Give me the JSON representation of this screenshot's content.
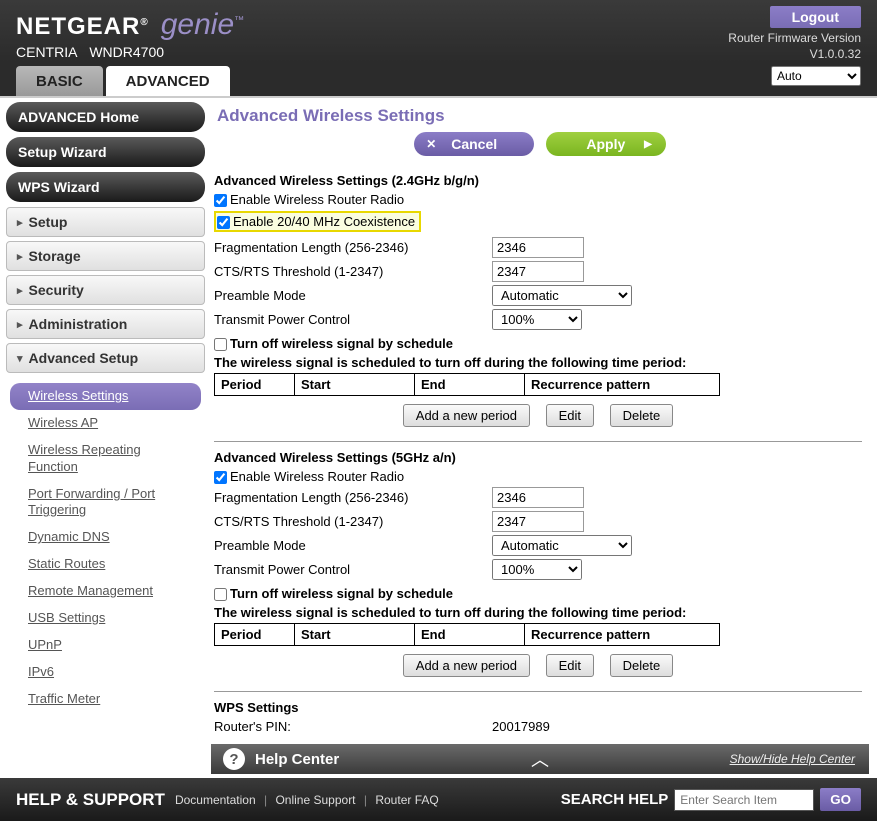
{
  "header": {
    "brand": "NETGEAR",
    "sub_brand": "genie",
    "model_line": "CENTRIA",
    "model_num": "WNDR4700",
    "logout": "Logout",
    "fw_label": "Router Firmware Version",
    "fw_version": "V1.0.0.32"
  },
  "tabs": {
    "basic": "BASIC",
    "advanced": "ADVANCED",
    "lang_selected": "Auto"
  },
  "sidebar": {
    "home": "ADVANCED Home",
    "setup_wizard": "Setup Wizard",
    "wps_wizard": "WPS Wizard",
    "groups": {
      "setup": "Setup",
      "storage": "Storage",
      "security": "Security",
      "admin": "Administration",
      "adv_setup": "Advanced Setup"
    },
    "adv_items": [
      "Wireless Settings",
      "Wireless AP",
      "Wireless Repeating Function",
      "Port Forwarding / Port Triggering",
      "Dynamic DNS",
      "Static Routes",
      "Remote Management",
      "USB Settings",
      "UPnP",
      "IPv6",
      "Traffic Meter"
    ]
  },
  "page": {
    "title": "Advanced Wireless Settings",
    "cancel": "Cancel",
    "apply": "Apply"
  },
  "s24": {
    "heading": "Advanced Wireless Settings (2.4GHz b/g/n)",
    "enable_radio": "Enable Wireless Router Radio",
    "enable_coex": "Enable 20/40 MHz Coexistence",
    "frag_label": "Fragmentation Length (256-2346)",
    "frag_value": "2346",
    "cts_label": "CTS/RTS Threshold (1-2347)",
    "cts_value": "2347",
    "preamble_label": "Preamble Mode",
    "preamble_value": "Automatic",
    "tx_label": "Transmit Power Control",
    "tx_value": "100%",
    "sched_off": "Turn off wireless signal by schedule",
    "sched_note": "The wireless signal is scheduled to turn off during the following time period:",
    "cols": {
      "period": "Period",
      "start": "Start",
      "end": "End",
      "recur": "Recurrence pattern"
    },
    "btns": {
      "add": "Add a new period",
      "edit": "Edit",
      "del": "Delete"
    }
  },
  "s5": {
    "heading": "Advanced Wireless Settings (5GHz a/n)",
    "enable_radio": "Enable Wireless Router Radio",
    "frag_label": "Fragmentation Length (256-2346)",
    "frag_value": "2346",
    "cts_label": "CTS/RTS Threshold (1-2347)",
    "cts_value": "2347",
    "preamble_label": "Preamble Mode",
    "preamble_value": "Automatic",
    "tx_label": "Transmit Power Control",
    "tx_value": "100%",
    "sched_off": "Turn off wireless signal by schedule",
    "sched_note": "The wireless signal is scheduled to turn off during the following time period:",
    "cols": {
      "period": "Period",
      "start": "Start",
      "end": "End",
      "recur": "Recurrence pattern"
    },
    "btns": {
      "add": "Add a new period",
      "edit": "Edit",
      "del": "Delete"
    }
  },
  "wps": {
    "heading": "WPS Settings",
    "pin_label": "Router's PIN:",
    "pin_value": "20017989"
  },
  "help": {
    "title": "Help Center",
    "toggle": "Show/Hide Help Center"
  },
  "footer": {
    "hs": "HELP & SUPPORT",
    "links": {
      "doc": "Documentation",
      "online": "Online Support",
      "faq": "Router FAQ"
    },
    "search_label": "SEARCH HELP",
    "search_placeholder": "Enter Search Item",
    "go": "GO"
  }
}
